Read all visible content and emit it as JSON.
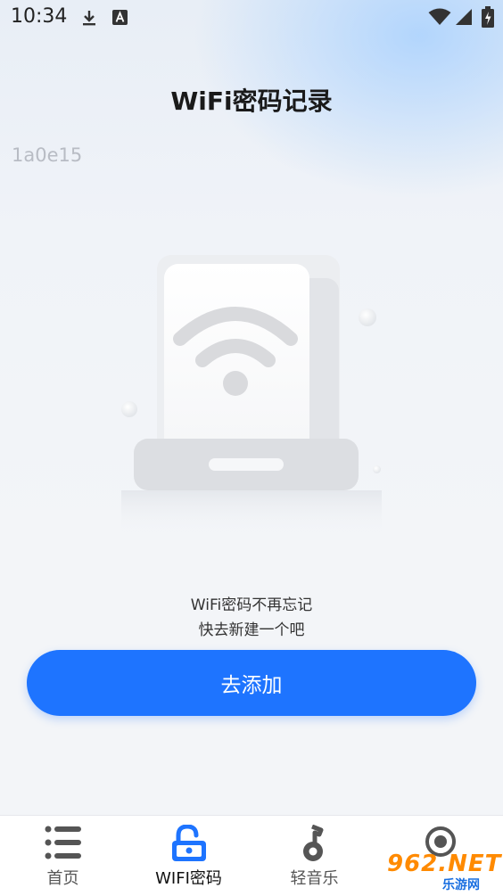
{
  "status_bar": {
    "time": "10:34",
    "icons": [
      "download-icon",
      "a-badge-icon",
      "wifi-signal-icon",
      "cell-signal-icon",
      "battery-charging-icon"
    ]
  },
  "header": {
    "title": "WiFi密码记录"
  },
  "device_id": "1a0e15",
  "empty_state": {
    "line1": "WiFi密码不再忘记",
    "line2": "快去新建一个吧",
    "illustration": "wifi-router-icon"
  },
  "add_button": {
    "label": "去添加"
  },
  "bottom_nav": {
    "items": [
      {
        "label": "首页",
        "icon": "list-icon"
      },
      {
        "label": "WIFI密码",
        "icon": "unlock-icon",
        "active": true
      },
      {
        "label": "轻音乐",
        "icon": "music-note-icon"
      },
      {
        "label": "",
        "icon": "circle-icon"
      }
    ]
  },
  "watermark": {
    "text": "962.NET",
    "sub": "乐游网"
  },
  "colors": {
    "accent": "#1e74ff",
    "title": "#1a1a1a",
    "muted": "#b8bcc4"
  }
}
